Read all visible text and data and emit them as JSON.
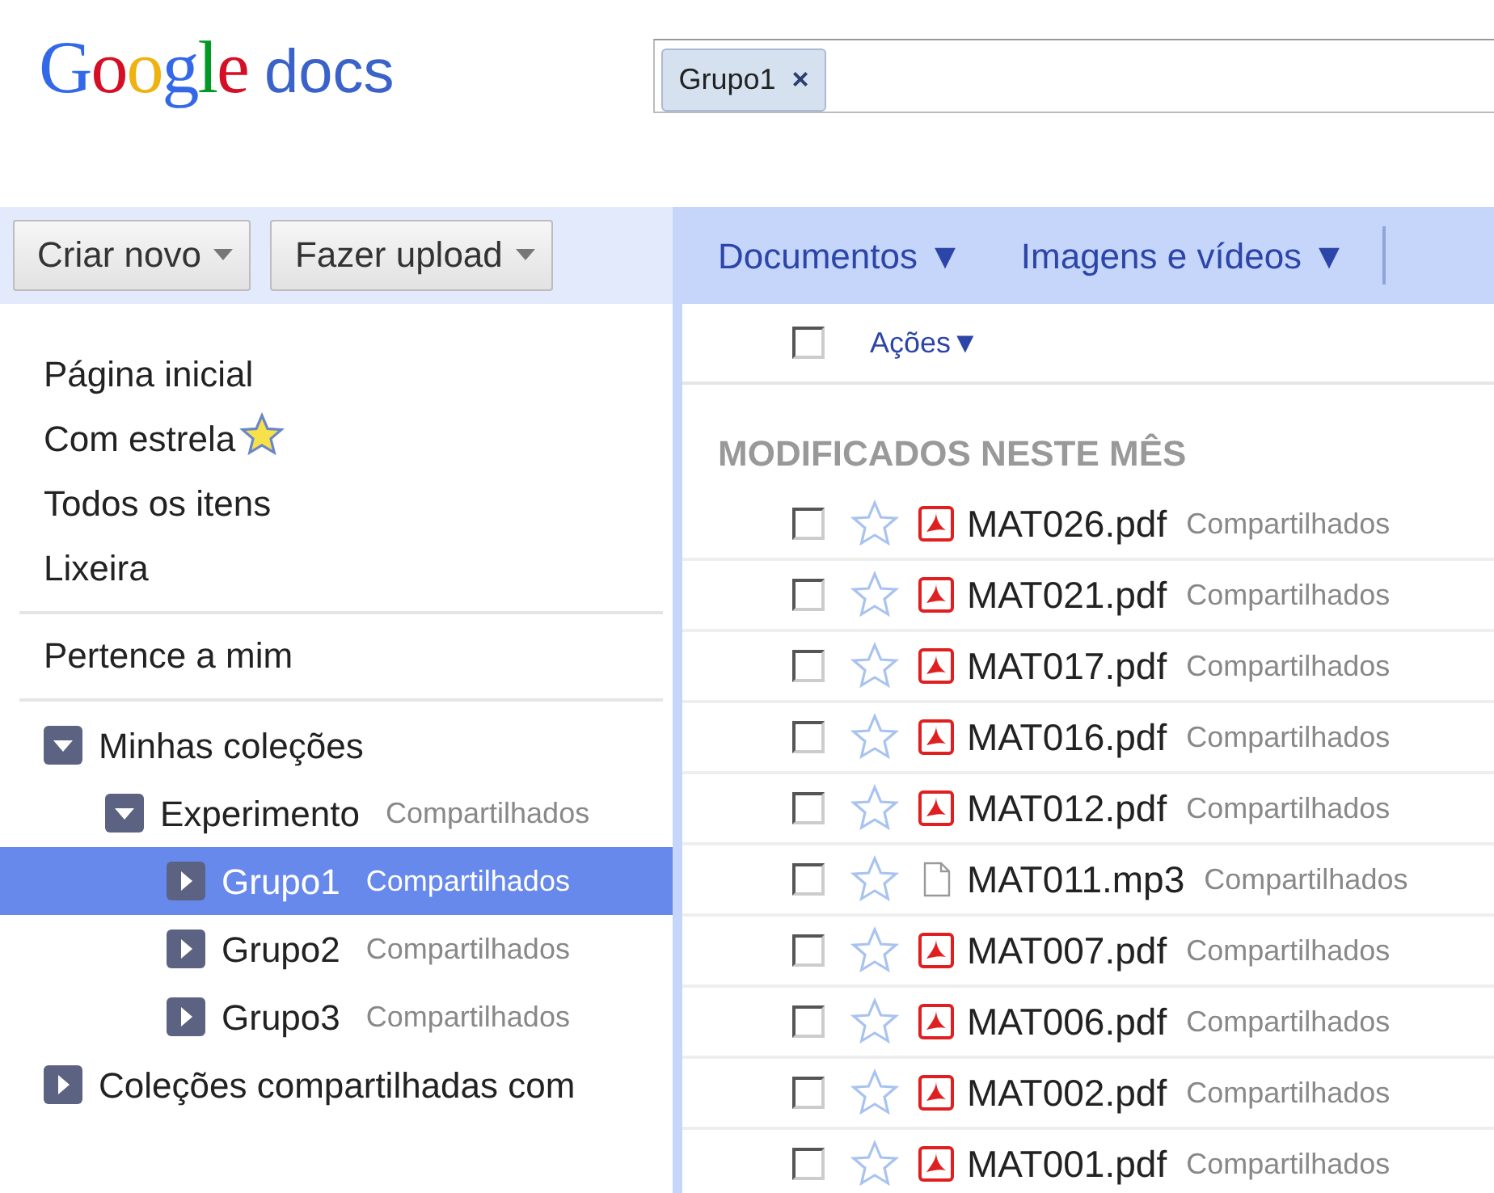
{
  "logo": {
    "brand": "Google",
    "product": "docs"
  },
  "search": {
    "chips": [
      {
        "label": "Grupo1",
        "remove": "×"
      }
    ]
  },
  "toolbar": {
    "buttons": [
      "Criar novo",
      "Fazer upload"
    ],
    "tabs": [
      "Documentos ▼",
      "Imagens e vídeos ▼"
    ]
  },
  "sidebar": {
    "groups": [
      [
        {
          "label": "Página inicial",
          "kind": "plain"
        },
        {
          "label": "Com estrela",
          "kind": "starred"
        },
        {
          "label": "Todos os itens",
          "kind": "plain"
        },
        {
          "label": "Lixeira",
          "kind": "plain"
        }
      ],
      [
        {
          "label": "Pertence a mim",
          "kind": "plain"
        }
      ]
    ],
    "tree": [
      {
        "label": "Minhas coleções",
        "expanded": true,
        "selected": false,
        "children": [
          {
            "label": "Experimento",
            "tag": "Compartilhados",
            "expanded": true,
            "selected": false,
            "children": [
              {
                "label": "Grupo1",
                "tag": "Compartilhados",
                "expanded": false,
                "selected": true
              },
              {
                "label": "Grupo2",
                "tag": "Compartilhados",
                "expanded": false,
                "selected": false
              },
              {
                "label": "Grupo3",
                "tag": "Compartilhados",
                "expanded": false,
                "selected": false
              }
            ]
          }
        ]
      },
      {
        "label": "Coleções compartilhadas com",
        "expanded": false,
        "selected": false
      }
    ]
  },
  "list": {
    "select_all": {
      "checked": false
    },
    "actions": "Ações▼",
    "section_title": "MODIFICADOS NESTE MÊS",
    "files": [
      {
        "name": "MAT026.pdf",
        "tag": "Compartilhados",
        "kind": "pdf",
        "checked": false,
        "starred": false
      },
      {
        "name": "MAT021.pdf",
        "tag": "Compartilhados",
        "kind": "pdf",
        "checked": false,
        "starred": false
      },
      {
        "name": "MAT017.pdf",
        "tag": "Compartilhados",
        "kind": "pdf",
        "checked": false,
        "starred": false
      },
      {
        "name": "MAT016.pdf",
        "tag": "Compartilhados",
        "kind": "pdf",
        "checked": false,
        "starred": false
      },
      {
        "name": "MAT012.pdf",
        "tag": "Compartilhados",
        "kind": "pdf",
        "checked": false,
        "starred": false
      },
      {
        "name": "MAT011.mp3",
        "tag": "Compartilhados",
        "kind": "blank",
        "checked": false,
        "starred": false
      },
      {
        "name": "MAT007.pdf",
        "tag": "Compartilhados",
        "kind": "pdf",
        "checked": false,
        "starred": false
      },
      {
        "name": "MAT006.pdf",
        "tag": "Compartilhados",
        "kind": "pdf",
        "checked": false,
        "starred": false
      },
      {
        "name": "MAT002.pdf",
        "tag": "Compartilhados",
        "kind": "pdf",
        "checked": false,
        "starred": false
      },
      {
        "name": "MAT001.pdf",
        "tag": "Compartilhados",
        "kind": "pdf",
        "checked": false,
        "starred": false
      }
    ]
  }
}
